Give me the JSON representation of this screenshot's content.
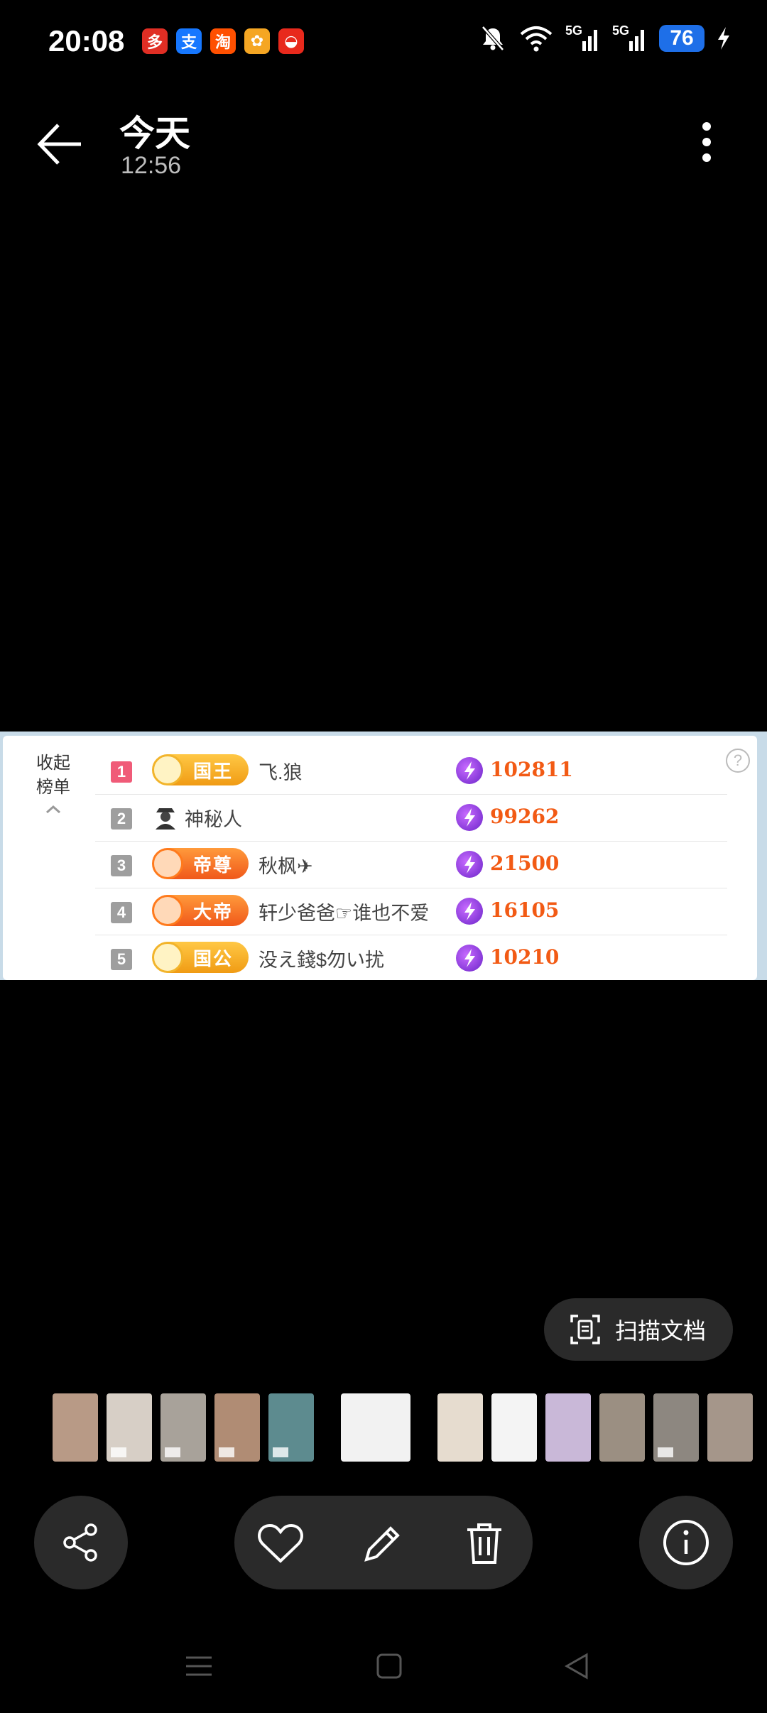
{
  "status_bar": {
    "time": "20:08",
    "app_icons": [
      {
        "name": "pinduoduo-icon",
        "glyph": "多",
        "color": "#e02e24"
      },
      {
        "name": "alipay-icon",
        "glyph": "支",
        "color": "#1677ff"
      },
      {
        "name": "taobao-icon",
        "glyph": "淘",
        "color": "#ff5000"
      },
      {
        "name": "photos-icon",
        "glyph": "✿",
        "color": "#f5a623"
      },
      {
        "name": "shopping-icon",
        "glyph": "◒",
        "color": "#e8291c"
      }
    ],
    "signal_1": "5G",
    "signal_2": "5G",
    "battery": "76"
  },
  "header": {
    "title": "今天",
    "subtitle": "12:56"
  },
  "leaderboard": {
    "collapse_line1": "收起",
    "collapse_line2": "榜单",
    "help": "?",
    "rows": [
      {
        "rank": "1",
        "badge": "国王",
        "badge_style": "gold",
        "name": "飞.狼",
        "score": "102811"
      },
      {
        "rank": "2",
        "badge": "",
        "badge_style": "anon",
        "name": "神秘人",
        "score": "99262"
      },
      {
        "rank": "3",
        "badge": "帝尊",
        "badge_style": "orange",
        "name": "秋枫✈",
        "score": "21500"
      },
      {
        "rank": "4",
        "badge": "大帝",
        "badge_style": "orange",
        "name": "轩少爸爸☞谁也不爱",
        "score": "16105"
      },
      {
        "rank": "5",
        "badge": "国公",
        "badge_style": "gold",
        "name": "没え錢$勿い扰",
        "score": "10210"
      }
    ]
  },
  "scan": {
    "label": "扫描文档"
  },
  "thumbnails": [
    {
      "kind": "photo",
      "color": "#b89a86"
    },
    {
      "kind": "video",
      "color": "#d7cfc6"
    },
    {
      "kind": "video",
      "color": "#a8a29a"
    },
    {
      "kind": "video",
      "color": "#b08c74"
    },
    {
      "kind": "video",
      "color": "#5d8b8f"
    },
    {
      "kind": "gap",
      "color": "#000000"
    },
    {
      "kind": "screenshot",
      "color": "#f2f2f2"
    },
    {
      "kind": "gap",
      "color": "#000000"
    },
    {
      "kind": "screenshot",
      "color": "#e6dccf"
    },
    {
      "kind": "screenshot",
      "color": "#f4f4f4"
    },
    {
      "kind": "screenshot",
      "color": "#c9b8d8"
    },
    {
      "kind": "photo",
      "color": "#9b8f82"
    },
    {
      "kind": "video",
      "color": "#8d8780"
    },
    {
      "kind": "photo",
      "color": "#a5968a"
    }
  ]
}
